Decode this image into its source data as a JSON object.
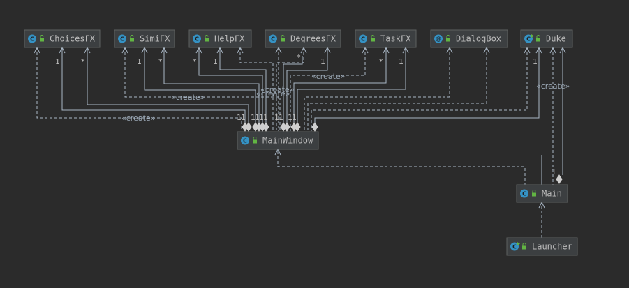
{
  "diagram": {
    "nodes": [
      {
        "id": "ChoicesFX",
        "label": "ChoicesFX",
        "kind": "class"
      },
      {
        "id": "SimiFX",
        "label": "SimiFX",
        "kind": "class"
      },
      {
        "id": "HelpFX",
        "label": "HelpFX",
        "kind": "class"
      },
      {
        "id": "DegreesFX",
        "label": "DegreesFX",
        "kind": "class"
      },
      {
        "id": "TaskFX",
        "label": "TaskFX",
        "kind": "class"
      },
      {
        "id": "DialogBox",
        "label": "DialogBox",
        "kind": "annotation"
      },
      {
        "id": "Duke",
        "label": "Duke",
        "kind": "class-main"
      },
      {
        "id": "MainWindow",
        "label": "MainWindow",
        "kind": "class"
      },
      {
        "id": "Main",
        "label": "Main",
        "kind": "class"
      },
      {
        "id": "Launcher",
        "label": "Launcher",
        "kind": "class-main"
      }
    ],
    "icon_letters": {
      "class": "C",
      "class-main": "C",
      "annotation": "@"
    },
    "stereotype": "«create»",
    "multiplicity_labels": [
      "1",
      "*"
    ],
    "colors": {
      "background": "#2b2b2b",
      "node_fill": "#3c3f41",
      "node_border": "#5e6060",
      "text": "#bbbbbb",
      "edge": "#a9b7c6",
      "class_icon": "#3592c4",
      "public_lock": "#62b543"
    }
  }
}
